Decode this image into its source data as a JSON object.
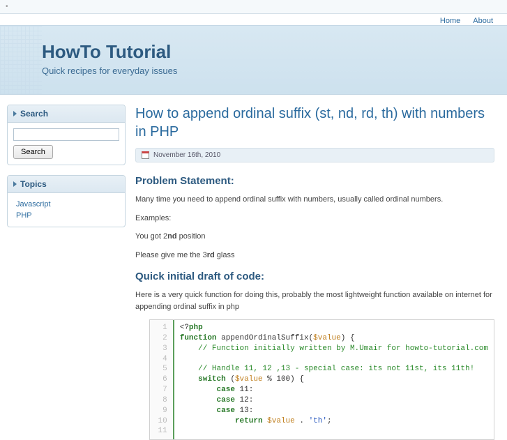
{
  "topbar": {
    "item1": "",
    "item2": ""
  },
  "nav": {
    "home": "Home",
    "about": "About"
  },
  "header": {
    "title": "HowTo Tutorial",
    "tagline": "Quick recipes for everyday issues"
  },
  "sidebar": {
    "search": {
      "title": "Search",
      "button": "Search",
      "placeholder": ""
    },
    "topics": {
      "title": "Topics",
      "items": [
        "Javascript",
        "PHP"
      ]
    }
  },
  "post": {
    "title": "How to append ordinal suffix (st, nd, rd, th) with numbers in PHP",
    "date": "November 16th, 2010",
    "section1": "Problem Statement:",
    "p1": "Many time you need to append ordinal suffix with numbers, usually called ordinal numbers.",
    "p2": "Examples:",
    "p3a": "You got 2",
    "p3b": "nd",
    "p3c": " position",
    "p4a": "Please give me the 3",
    "p4b": "rd",
    "p4c": " glass",
    "section2": "Quick initial draft of code:",
    "p5": "Here is a very quick function for doing this, probably the most lightweight function available on internet for appending ordinal suffix in php",
    "code": {
      "l1a": "<?",
      "l1b": "php",
      "l2a": "function",
      "l2b": " appendOrdinalSuffix(",
      "l2c": "$value",
      "l2d": ") {",
      "l3": "    // Function initially written by M.Umair for howto-tutorial.com",
      "l5": "    // Handle 11, 12 ,13 - special case: its not 11st, its 11th!",
      "l6a": "    ",
      "l6b": "switch",
      "l6c": " (",
      "l6d": "$value",
      "l6e": " % 100) {",
      "l7a": "        ",
      "l7b": "case",
      "l7c": " 11:",
      "l8a": "        ",
      "l8b": "case",
      "l8c": " 12:",
      "l9a": "        ",
      "l9b": "case",
      "l9c": " 13:",
      "l10a": "            ",
      "l10b": "return",
      "l10c": " ",
      "l10d": "$value",
      "l10e": " . ",
      "l10f": "'th'",
      "l10g": ";"
    }
  }
}
